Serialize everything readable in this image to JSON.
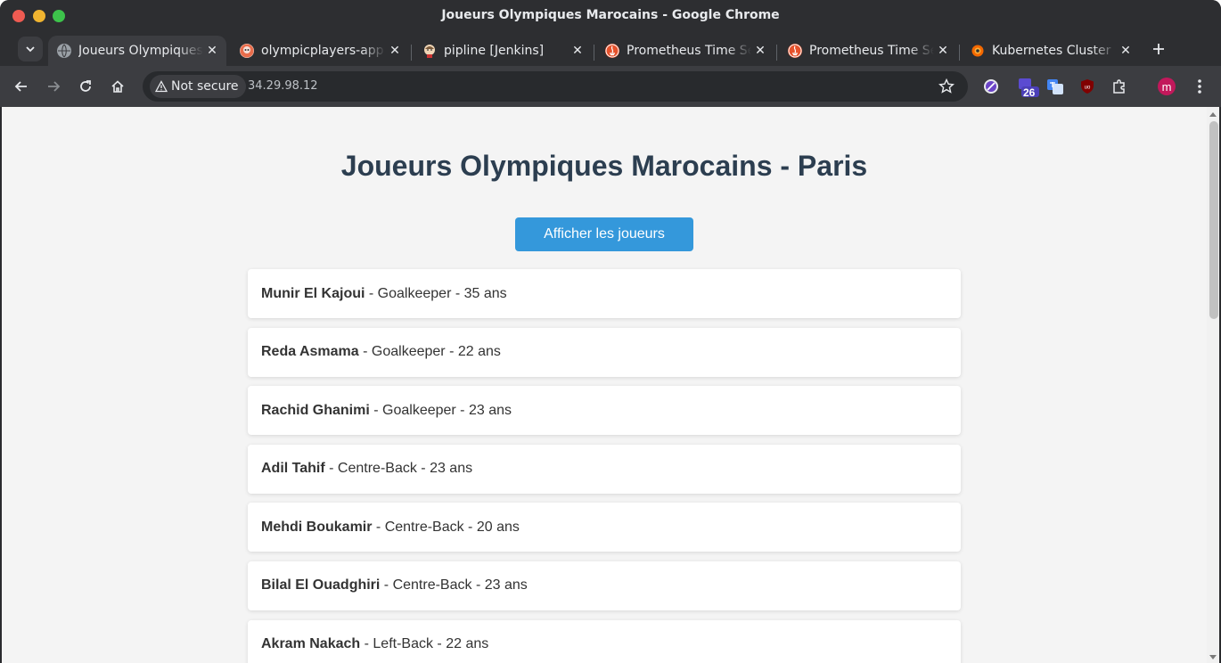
{
  "window": {
    "title": "Joueurs Olympiques Marocains - Google Chrome"
  },
  "tabs": [
    {
      "label": "Joueurs Olympiques Marocains",
      "icon": "globe-icon",
      "active": true
    },
    {
      "label": "olympicplayers-app",
      "icon": "argocd-icon",
      "active": false
    },
    {
      "label": "pipline [Jenkins]",
      "icon": "jenkins-icon",
      "active": false
    },
    {
      "label": "Prometheus Time Series",
      "icon": "prometheus-icon",
      "active": false
    },
    {
      "label": "Prometheus Time Series",
      "icon": "prometheus-icon",
      "active": false
    },
    {
      "label": "Kubernetes Cluster",
      "icon": "grafana-icon",
      "active": false
    }
  ],
  "toolbar": {
    "security_label": "Not secure",
    "url": "34.29.98.12",
    "extension_badge": "26",
    "profile_initial": "m"
  },
  "page": {
    "title": "Joueurs Olympiques Marocains - Paris",
    "button_label": "Afficher les joueurs",
    "players": [
      {
        "name": "Munir El Kajoui",
        "details": " - Goalkeeper - 35 ans"
      },
      {
        "name": "Reda Asmama",
        "details": " - Goalkeeper - 22 ans"
      },
      {
        "name": "Rachid Ghanimi",
        "details": " - Goalkeeper - 23 ans"
      },
      {
        "name": "Adil Tahif",
        "details": " - Centre-Back - 23 ans"
      },
      {
        "name": "Mehdi Boukamir",
        "details": " - Centre-Back - 20 ans"
      },
      {
        "name": "Bilal El Ouadghiri",
        "details": " - Centre-Back - 23 ans"
      },
      {
        "name": "Akram Nakach",
        "details": " - Left-Back - 22 ans"
      }
    ]
  },
  "colors": {
    "accent": "#3498db",
    "title_text": "#2c3e50",
    "page_bg": "#f4f4f4"
  }
}
